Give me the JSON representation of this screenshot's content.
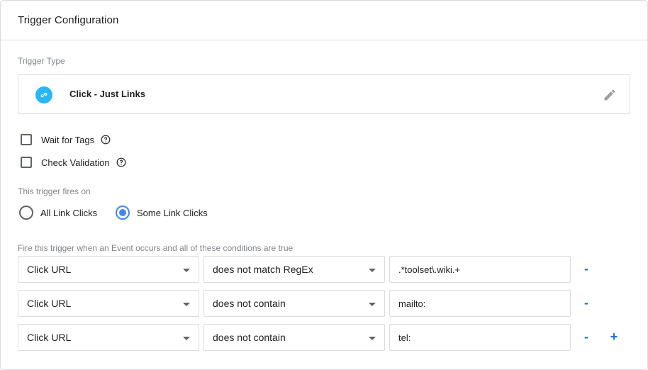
{
  "header": {
    "title": "Trigger Configuration"
  },
  "trigger_type": {
    "section_label": "Trigger Type",
    "name": "Click - Just Links",
    "icon": "link-icon",
    "icon_color": "#29b6f6"
  },
  "options": {
    "wait_for_tags": {
      "label": "Wait for Tags",
      "checked": false
    },
    "check_validation": {
      "label": "Check Validation",
      "checked": false
    }
  },
  "fires_on": {
    "label": "This trigger fires on",
    "options": [
      {
        "label": "All Link Clicks",
        "selected": false
      },
      {
        "label": "Some Link Clicks",
        "selected": true
      }
    ]
  },
  "conditions": {
    "label": "Fire this trigger when an Event occurs and all of these conditions are true",
    "rows": [
      {
        "variable": "Click URL",
        "operator": "does not match RegEx",
        "value": ".*toolset\\.wiki.+"
      },
      {
        "variable": "Click URL",
        "operator": "does not contain",
        "value": "mailto:"
      },
      {
        "variable": "Click URL",
        "operator": "does not contain",
        "value": "tel:"
      }
    ],
    "remove_label": "-",
    "add_label": "+"
  },
  "colors": {
    "accent": "#1a73e8",
    "radio": "#4285f4",
    "border": "#dadce0"
  }
}
